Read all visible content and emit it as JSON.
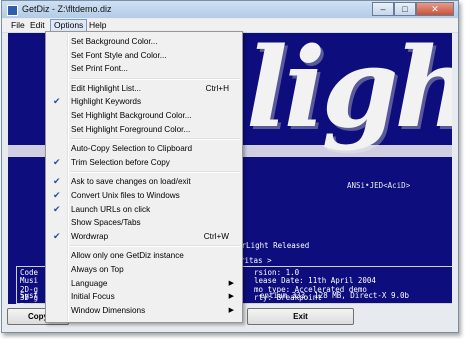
{
  "window": {
    "title": "GetDiz - Z:\\fltdemo.diz",
    "minimize": "–",
    "maximize": "□",
    "close": "✕"
  },
  "menubar": [
    "File",
    "Edit",
    "Options",
    "Help"
  ],
  "screen": {
    "logo_text": "light",
    "ansi_tag": "ANSi•JED<AciD>",
    "release_line": "FairLight Released",
    "ritas": "ritas >",
    "left_lines": "Code\nMusi\n2D-g\n3D-g\nBrut",
    "right_lines": "rsion: 1.0\nlease Date: 11th April 2004\nmo type: Accelerated demo\nrty: Breakpoint",
    "sys_left": "Syst",
    "sys_right": "entium 333, 128 MB, Direct-X 9.0b"
  },
  "buttons": {
    "copy": "Copy",
    "exit": "Exit"
  },
  "options_menu": [
    {
      "label": "Set Background Color...",
      "checked": false
    },
    {
      "label": "Set Font Style and Color...",
      "checked": false
    },
    {
      "label": "Set Print Font...",
      "checked": false
    },
    {
      "separator": true
    },
    {
      "label": "Edit Highlight List...",
      "shortcut": "Ctrl+H",
      "checked": false
    },
    {
      "label": "Highlight Keywords",
      "checked": true
    },
    {
      "label": "Set Highlight Background Color...",
      "checked": false
    },
    {
      "label": "Set Highlight Foreground Color...",
      "checked": false
    },
    {
      "separator": true
    },
    {
      "label": "Auto-Copy Selection to Clipboard",
      "checked": false
    },
    {
      "label": "Trim Selection before Copy",
      "checked": true
    },
    {
      "separator": true
    },
    {
      "label": "Ask to save changes on load/exit",
      "checked": true
    },
    {
      "label": "Convert Unix files to Windows",
      "checked": true
    },
    {
      "label": "Launch URLs on click",
      "checked": true
    },
    {
      "label": "Show Spaces/Tabs",
      "checked": false
    },
    {
      "label": "Wordwrap",
      "shortcut": "Ctrl+W",
      "checked": true
    },
    {
      "separator": true
    },
    {
      "label": "Allow only one GetDiz instance",
      "checked": false
    },
    {
      "label": "Always on Top",
      "checked": false
    },
    {
      "label": "Language",
      "submenu": true,
      "checked": false
    },
    {
      "label": "Initial Focus",
      "submenu": true,
      "checked": false
    },
    {
      "label": "Window Dimensions",
      "submenu": true,
      "checked": false
    }
  ],
  "colors": {
    "screen_bg": "#0d0d7e",
    "check": "#1c4f9c",
    "menu_bg": "#f0f0f0"
  }
}
